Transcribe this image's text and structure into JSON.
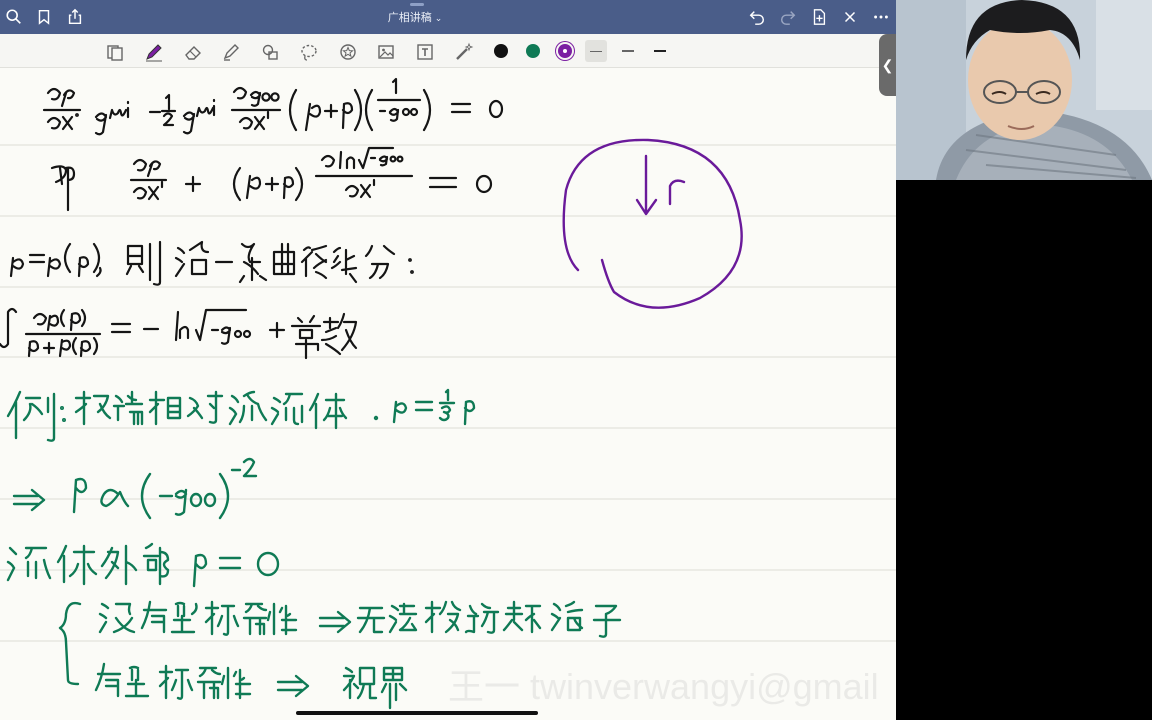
{
  "titlebar": {
    "title": "广相讲稿",
    "title_chevron": "⌄",
    "icons": [
      "search-icon",
      "bookmark-icon",
      "share-icon",
      "undo-icon",
      "redo-icon",
      "add-page-icon",
      "close-icon",
      "more-icon"
    ]
  },
  "toolbar": {
    "tools": [
      "page-layout-icon",
      "pen-icon",
      "eraser-icon",
      "highlighter-icon",
      "shapes-icon",
      "lasso-icon",
      "sticker-icon",
      "image-icon",
      "text-icon",
      "laser-pointer-icon"
    ],
    "colors": [
      "#111111",
      "#0f7a55",
      "#7b1fa2"
    ],
    "stroke_widths": [
      "thin",
      "medium",
      "thick"
    ]
  },
  "side_tab": {
    "label": "❮"
  },
  "watermark": "王一 twinverwangyi@gmail",
  "colors": {
    "titlebar": "#4a5d89",
    "ink_black": "#111111",
    "ink_green": "#0f7a55",
    "ink_purple": "#6a1a9a"
  }
}
